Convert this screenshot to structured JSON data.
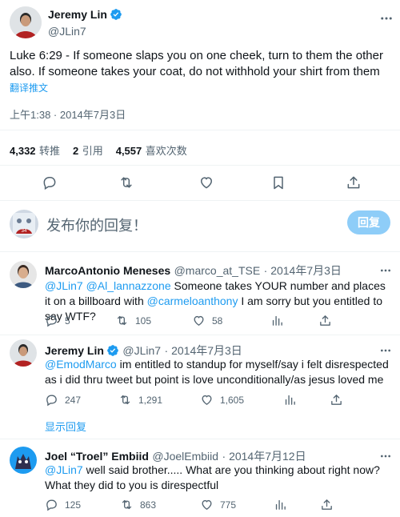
{
  "main_tweet": {
    "author_name": "Jeremy Lin",
    "author_handle": "@JLin7",
    "text": "Luke 6:29 - If someone slaps you on one cheek, turn to them the other also. If someone takes your coat, do not withhold your shirt from them",
    "translate_label": "翻译推文",
    "timestamp": "上午1:38 · 2014年7月3日",
    "stats": {
      "retweets_num": "4,332",
      "retweets_label": "转推",
      "quotes_num": "2",
      "quotes_label": "引用",
      "likes_num": "4,557",
      "likes_label": "喜欢次数"
    }
  },
  "composer": {
    "placeholder": "发布你的回复！",
    "button_label": "回复"
  },
  "replies": [
    {
      "author_name": "MarcoAntonio Meneses",
      "author_handle": "@marco_at_TSE",
      "date": "· 2014年7月3日",
      "mentions": "@JLin7 @Al_lannazzone",
      "text_a": " Someone takes YOUR number and places it on a billboard with ",
      "mention2": "@carmeloanthony",
      "text_b": " I am sorry but you entitled to say WTF?",
      "reply_count": "5",
      "retweet_count": "105",
      "like_count": "58"
    },
    {
      "author_name": "Jeremy Lin",
      "author_handle": "@JLin7",
      "date": "· 2014年7月3日",
      "mentions": "@EmodMarco",
      "text_a": " im entitled to standup for myself/say i felt disrespected as i did thru tweet but point is love unconditionally/as jesus loved me",
      "reply_count": "247",
      "retweet_count": "1,291",
      "like_count": "1,605",
      "show_replies": "显示回复"
    },
    {
      "author_name": "Joel “Troel” Embiid",
      "author_handle": "@JoelEmbiid",
      "date": "· 2014年7月12日",
      "mentions": "@JLin7",
      "text_a": " well said brother..... What are you thinking about right now? What they did to you is direspectful",
      "reply_count": "125",
      "retweet_count": "863",
      "like_count": "775"
    }
  ],
  "colors": {
    "accent": "#1d9bf0",
    "reply_button_disabled": "#8ecdf8",
    "text_primary": "#0f1419",
    "text_secondary": "#536471",
    "divider": "#eff3f4"
  },
  "icons": {
    "verified": "verified-badge-icon",
    "more": "more-icon",
    "reply": "reply-icon",
    "retweet": "retweet-icon",
    "like": "like-icon",
    "bookmark": "bookmark-icon",
    "share": "share-icon",
    "views": "views-icon"
  }
}
